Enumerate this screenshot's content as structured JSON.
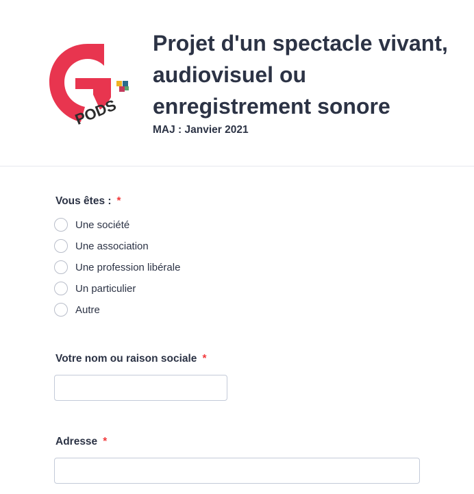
{
  "header": {
    "title": "Projet d'un spectacle vivant, audiovisuel ou enregistrement sonore",
    "subtitle": "MAJ : Janvier 2021",
    "logo_text": "PODS",
    "logo_letter": "G"
  },
  "colors": {
    "brand_red": "#e8354f",
    "required": "#f23a3c",
    "text": "#2c3345"
  },
  "form": {
    "q1": {
      "label": "Vous êtes :",
      "required_mark": "*",
      "options": [
        "Une société",
        "Une association",
        "Une profession libérale",
        "Un particulier",
        "Autre"
      ]
    },
    "q2": {
      "label": "Votre nom ou raison sociale",
      "required_mark": "*",
      "value": "",
      "placeholder": ""
    },
    "q3": {
      "label": "Adresse",
      "required_mark": "*",
      "value": "",
      "placeholder": ""
    }
  }
}
